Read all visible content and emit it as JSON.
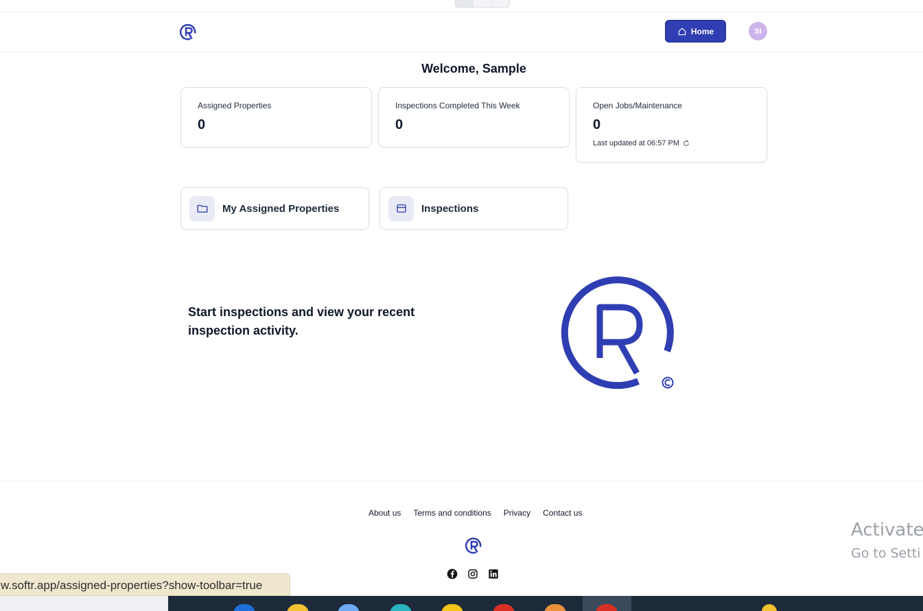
{
  "header": {
    "home_label": "Home",
    "avatar_initials": "SI",
    "accent_color": "#2f3eb2"
  },
  "welcome": "Welcome, Sample",
  "stats": [
    {
      "label": "Assigned Properties",
      "value": "0"
    },
    {
      "label": "Inspections Completed This Week",
      "value": "0"
    },
    {
      "label": "Open Jobs/Maintenance",
      "value": "0",
      "updated": "Last updated at 06:57 PM"
    }
  ],
  "nav_cards": [
    {
      "label": "My Assigned Properties",
      "icon": "folder-icon"
    },
    {
      "label": "Inspections",
      "icon": "window-icon"
    }
  ],
  "hero": {
    "text": "Start inspections and view your recent inspection activity."
  },
  "footer": {
    "links": [
      "About us",
      "Terms and conditions",
      "Privacy",
      "Contact us"
    ],
    "social": [
      "facebook-icon",
      "instagram-icon",
      "linkedin-icon"
    ]
  },
  "overlay": {
    "activate_line1": "Activate",
    "activate_line2": "Go to Setti",
    "status_url": "w.softr.app/assigned-properties?show-toolbar=true"
  }
}
